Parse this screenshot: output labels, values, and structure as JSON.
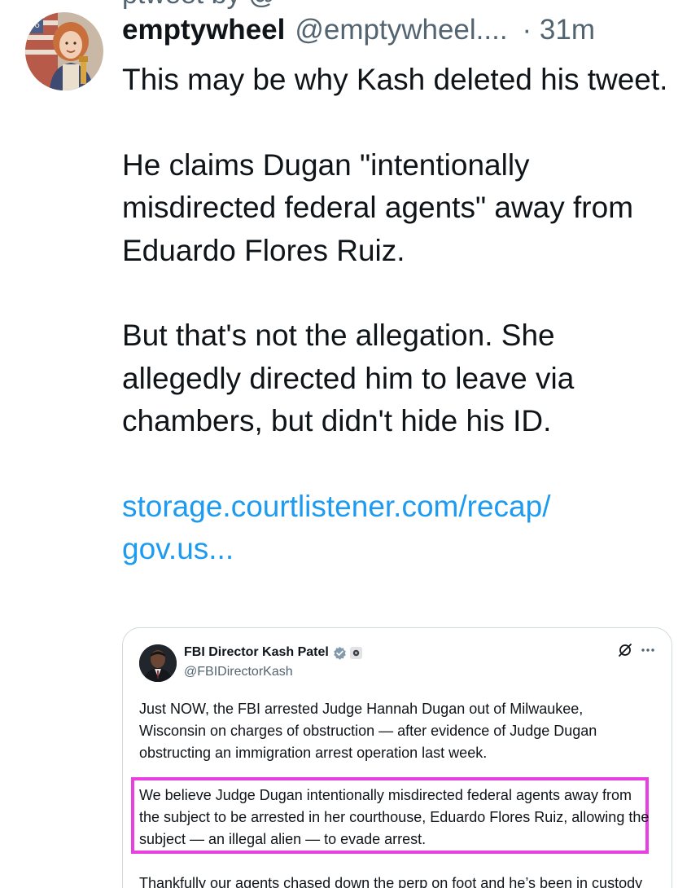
{
  "tweet": {
    "top_fragment": "ptweet by @",
    "display_name": "emptywheel",
    "handle": "@emptywheel....",
    "time": "· 31m",
    "paragraphs": [
      "This may be why Kash deleted his tweet.",
      "He claims Dugan \"intentionally misdirected federal agents\" away from Eduardo Flores Ruiz.",
      "But that's not the allegation. She allegedly directed him to leave via chambers, but didn't hide his ID."
    ],
    "link_line1": "storage.courtlistener.com/recap/",
    "link_line2": "gov.us..."
  },
  "quote": {
    "name": "FBI Director Kash Patel",
    "handle": "@FBIDirectorKash",
    "paragraph1": "Just NOW, the FBI arrested Judge Hannah Dugan out of Milwaukee, Wisconsin on charges of obstruction — after evidence of Judge Dugan obstructing an immigration arrest operation last week.",
    "paragraph2": "We believe Judge Dugan intentionally misdirected federal agents away from the subject to be arrested in her courthouse, Eduardo Flores Ruiz, allowing the subject — an illegal alien — to evade arrest.",
    "paragraph3": "Thankfully our agents chased down the perp on foot and he’s been in custody since, but the Judge’s actions created increased danger to the public."
  },
  "colors": {
    "link": "#1d9bf0",
    "secondary_text": "#536471",
    "highlight_border": "#e83fe0",
    "verified_badge": "#829aab"
  },
  "icons": {
    "quote_actions": [
      "grok-icon",
      "more-icon"
    ],
    "badges": [
      "verified-badge-icon",
      "government-seal-icon"
    ]
  }
}
